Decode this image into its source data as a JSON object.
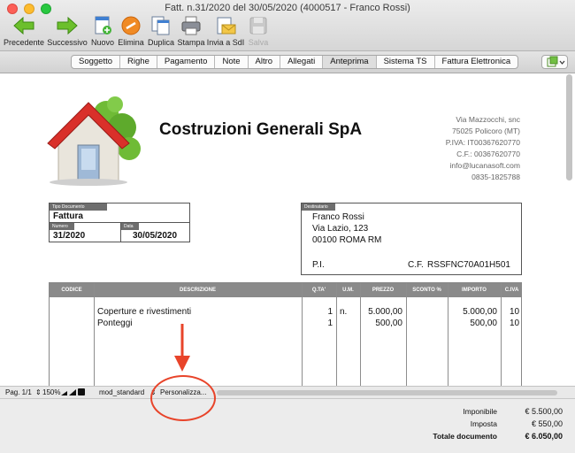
{
  "window": {
    "title": "Fatt. n.31/2020 del 30/05/2020 (4000517 - Franco Rossi)"
  },
  "toolbar": {
    "buttons": [
      {
        "label": "Precedente",
        "icon": "arrow-left-icon"
      },
      {
        "label": "Successivo",
        "icon": "arrow-right-icon"
      },
      {
        "label": "Nuovo",
        "icon": "new-document-icon"
      },
      {
        "label": "Elimina",
        "icon": "delete-icon"
      },
      {
        "label": "Duplica",
        "icon": "duplicate-icon"
      },
      {
        "label": "Stampa",
        "icon": "printer-icon"
      },
      {
        "label": "Invia a SdI",
        "icon": "send-sdi-icon"
      },
      {
        "label": "Salva",
        "icon": "save-icon"
      }
    ]
  },
  "tabs": [
    "Soggetto",
    "Righe",
    "Pagamento",
    "Note",
    "Altro",
    "Allegati",
    "Anteprima",
    "Sistema TS",
    "Fattura Elettronica"
  ],
  "active_tab": "Anteprima",
  "document": {
    "company_name": "Costruzioni Generali SpA",
    "company_address": [
      "Via Mazzocchi, snc",
      "75025 Policoro (MT)",
      "P.IVA: IT00367620770",
      "C.F.: 00367620770",
      "info@lucanasoft.com",
      "0835-1825788"
    ],
    "doc_type_label": "Tipo Documento",
    "doc_type": "Fattura",
    "number_label": "Numero",
    "number": "31/2020",
    "date_label": "Data",
    "date": "30/05/2020",
    "recipient_label": "Destinatario",
    "recipient": {
      "name": "Franco Rossi",
      "street": "Via Lazio, 123",
      "city": "00100 ROMA  RM",
      "pi_label": "P.I.",
      "cf_label": "C.F.",
      "cf": "RSSFNC70A01H501"
    },
    "columns": [
      "CODICE",
      "DESCRIZIONE",
      "Q.TA'",
      "U.M.",
      "PREZZO",
      "SCONTO %",
      "IMPORTO",
      "C.IVA"
    ],
    "rows": [
      {
        "codice": "",
        "descrizione": "Coperture e rivestimenti",
        "qta": "1",
        "um": "n.",
        "prezzo": "5.000,00",
        "sconto": "",
        "importo": "5.000,00",
        "civa": "10"
      },
      {
        "codice": "",
        "descrizione": "Ponteggi",
        "qta": "1",
        "um": "",
        "prezzo": "500,00",
        "sconto": "",
        "importo": "500,00",
        "civa": "10"
      }
    ]
  },
  "statusbar": {
    "page": "Pag. 1/1",
    "zoom": "150%",
    "template": "mod_standard",
    "customize": "Personalizza..."
  },
  "totals": {
    "imponibile_label": "Imponibile",
    "imponibile": "€ 5.500,00",
    "imposta_label": "Imposta",
    "imposta": "€ 550,00",
    "totale_label": "Totale documento",
    "totale": "€ 6.050,00"
  },
  "colors": {
    "annotation": "#e8442a",
    "table_header": "#8a8a8a"
  }
}
